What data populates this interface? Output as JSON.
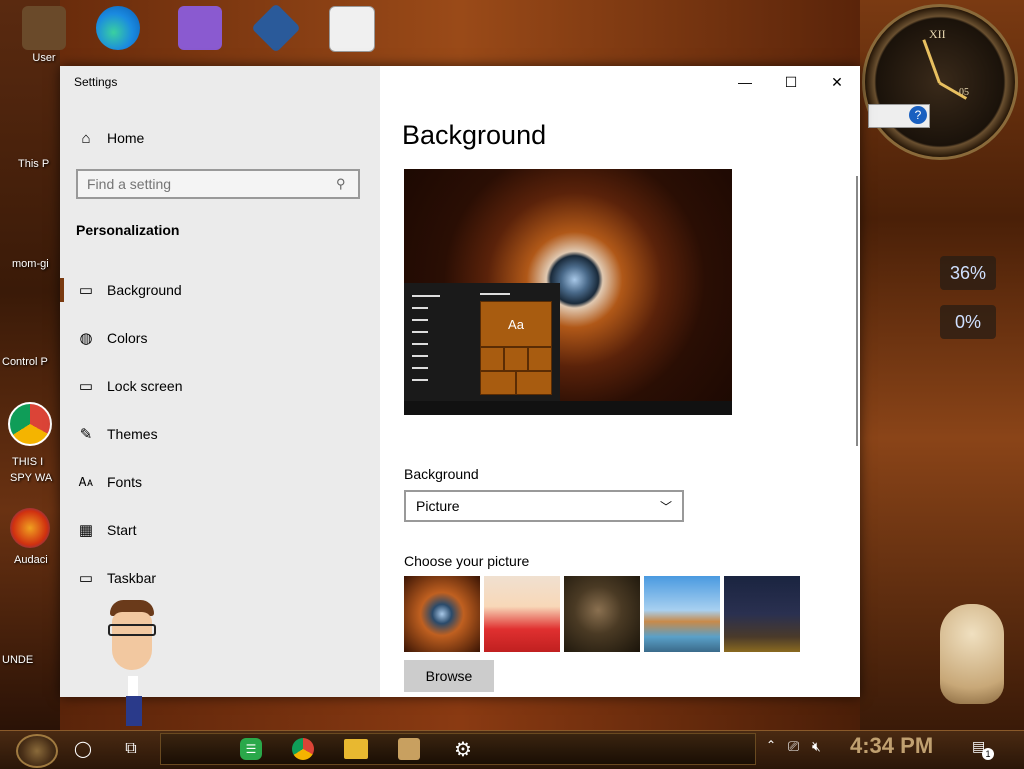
{
  "window": {
    "title": "Settings",
    "controls": {
      "minimize": "—",
      "maximize": "☐",
      "close": "✕"
    }
  },
  "nav": {
    "home": "Home",
    "search_placeholder": "Find a setting",
    "section": "Personalization",
    "items": [
      {
        "label": "Background",
        "icon": "picture-icon",
        "active": true
      },
      {
        "label": "Colors",
        "icon": "palette-icon"
      },
      {
        "label": "Lock screen",
        "icon": "lock-screen-icon"
      },
      {
        "label": "Themes",
        "icon": "themes-icon"
      },
      {
        "label": "Fonts",
        "icon": "fonts-icon"
      },
      {
        "label": "Start",
        "icon": "start-icon"
      },
      {
        "label": "Taskbar",
        "icon": "taskbar-icon"
      }
    ]
  },
  "content": {
    "title": "Background",
    "preview_tile_text": "Aa",
    "background_label": "Background",
    "background_value": "Picture",
    "choose_label": "Choose your picture",
    "browse_label": "Browse",
    "accent": "#a85c10"
  },
  "desktop": {
    "labels": [
      "User",
      "This P",
      "mom-gi",
      "Control P",
      "THIS I",
      "SPY WA",
      "Audaci",
      "UNDE"
    ],
    "gauges": [
      "36%",
      "0%"
    ],
    "clock_numerals": [
      "XII",
      "05"
    ]
  },
  "taskbar": {
    "clock": "4:34 PM",
    "notification_count": "1"
  }
}
